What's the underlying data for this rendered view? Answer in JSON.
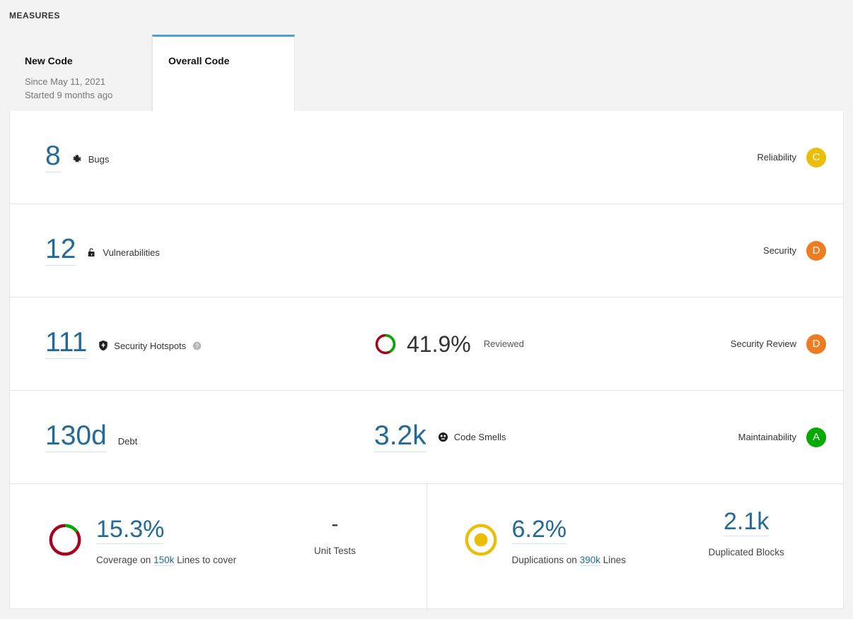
{
  "section": {
    "title": "MEASURES"
  },
  "tabs": [
    {
      "name": "New Code",
      "sub1": "Since May 11, 2021",
      "sub2": "Started 9 months ago",
      "active": false
    },
    {
      "name": "Overall Code",
      "sub1": "",
      "sub2": "",
      "active": true
    }
  ],
  "rows": {
    "bugs": {
      "value": "8",
      "label": "Bugs",
      "icon": "bug-icon",
      "rating_label": "Reliability",
      "rating": "C",
      "rating_color": "#eabe06"
    },
    "vulnerabilities": {
      "value": "12",
      "label": "Vulnerabilities",
      "icon": "open-lock-icon",
      "rating_label": "Security",
      "rating": "D",
      "rating_color": "#ed7d20"
    },
    "hotspots": {
      "value": "111",
      "label": "Security Hotspots",
      "icon": "shield-icon",
      "help_icon": "help-icon",
      "reviewed_pct": "41.9%",
      "reviewed_value": 41.9,
      "reviewed_label": "Reviewed",
      "reviewed_arc_color": "#00aa00",
      "reviewed_rest_color": "#a4041c",
      "rating_label": "Security Review",
      "rating": "D",
      "rating_color": "#ed7d20"
    },
    "maintainability": {
      "debt_value": "130d",
      "debt_label": "Debt",
      "smells_value": "3.2k",
      "smells_label": "Code Smells",
      "smells_icon": "code-smell-icon",
      "rating_label": "Maintainability",
      "rating": "A",
      "rating_color": "#00aa00"
    }
  },
  "bottom": {
    "coverage": {
      "pct": "15.3%",
      "pct_value": 15.3,
      "arc_color": "#00aa00",
      "rest_color": "#a4041c",
      "caption_pre": "Coverage on ",
      "lines_value": "150k",
      "caption_post": " Lines to cover"
    },
    "unit_tests": {
      "value": "-",
      "label": "Unit Tests"
    },
    "duplications": {
      "pct": "6.2%",
      "pct_value": 6.2,
      "indicator_color": "#eabe06",
      "caption_pre": "Duplications on ",
      "lines_value": "390k",
      "caption_post": " Lines"
    },
    "duplicated_blocks": {
      "value": "2.1k",
      "label": "Duplicated Blocks"
    }
  }
}
